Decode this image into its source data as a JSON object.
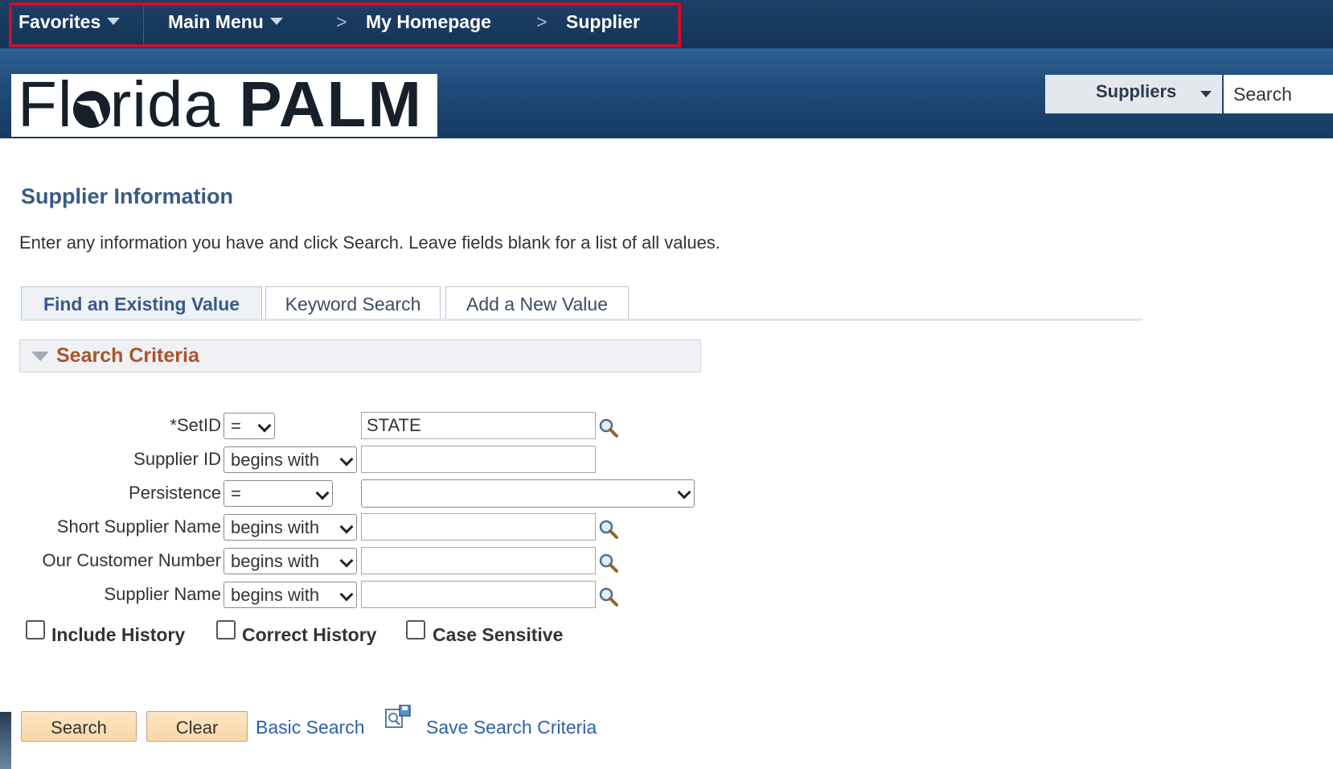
{
  "nav": {
    "favorites": "Favorites",
    "main_menu": "Main Menu",
    "crumb1": "My Homepage",
    "crumb2": "Supplier",
    "chevron": ">"
  },
  "logo": {
    "part1": "Fl",
    "part2": "rida",
    "part3": "PALM"
  },
  "global_search": {
    "category": "Suppliers",
    "placeholder": "Search"
  },
  "page": {
    "title": "Supplier Information",
    "instructions": "Enter any information you have and click Search. Leave fields blank for a list of all values."
  },
  "tabs": [
    {
      "label": "Find an Existing Value"
    },
    {
      "label": "Keyword Search"
    },
    {
      "label": "Add a New Value"
    }
  ],
  "criteria": {
    "header": "Search Criteria",
    "fields": [
      {
        "label": "*SetID",
        "operator": "=",
        "value": "STATE"
      },
      {
        "label": "Supplier ID",
        "operator": "begins with",
        "value": ""
      },
      {
        "label": "Persistence",
        "operator": "=",
        "value": ""
      },
      {
        "label": "Short Supplier Name",
        "operator": "begins with",
        "value": ""
      },
      {
        "label": "Our Customer Number",
        "operator": "begins with",
        "value": ""
      },
      {
        "label": "Supplier Name",
        "operator": "begins with",
        "value": ""
      }
    ]
  },
  "options": {
    "include_history": "Include History",
    "correct_history": "Correct History",
    "case_sensitive": "Case Sensitive"
  },
  "actions": {
    "search": "Search",
    "clear": "Clear",
    "basic_search": "Basic Search",
    "save_criteria": "Save Search Criteria"
  },
  "icons": {
    "lookup": "magnifier-icon",
    "save": "save-search-icon"
  },
  "colors": {
    "nav_bg": "#1c3f66",
    "highlight_box": "#c8102e",
    "title": "#385a86",
    "button": "#f8d7a8",
    "link": "#2c62a8"
  }
}
